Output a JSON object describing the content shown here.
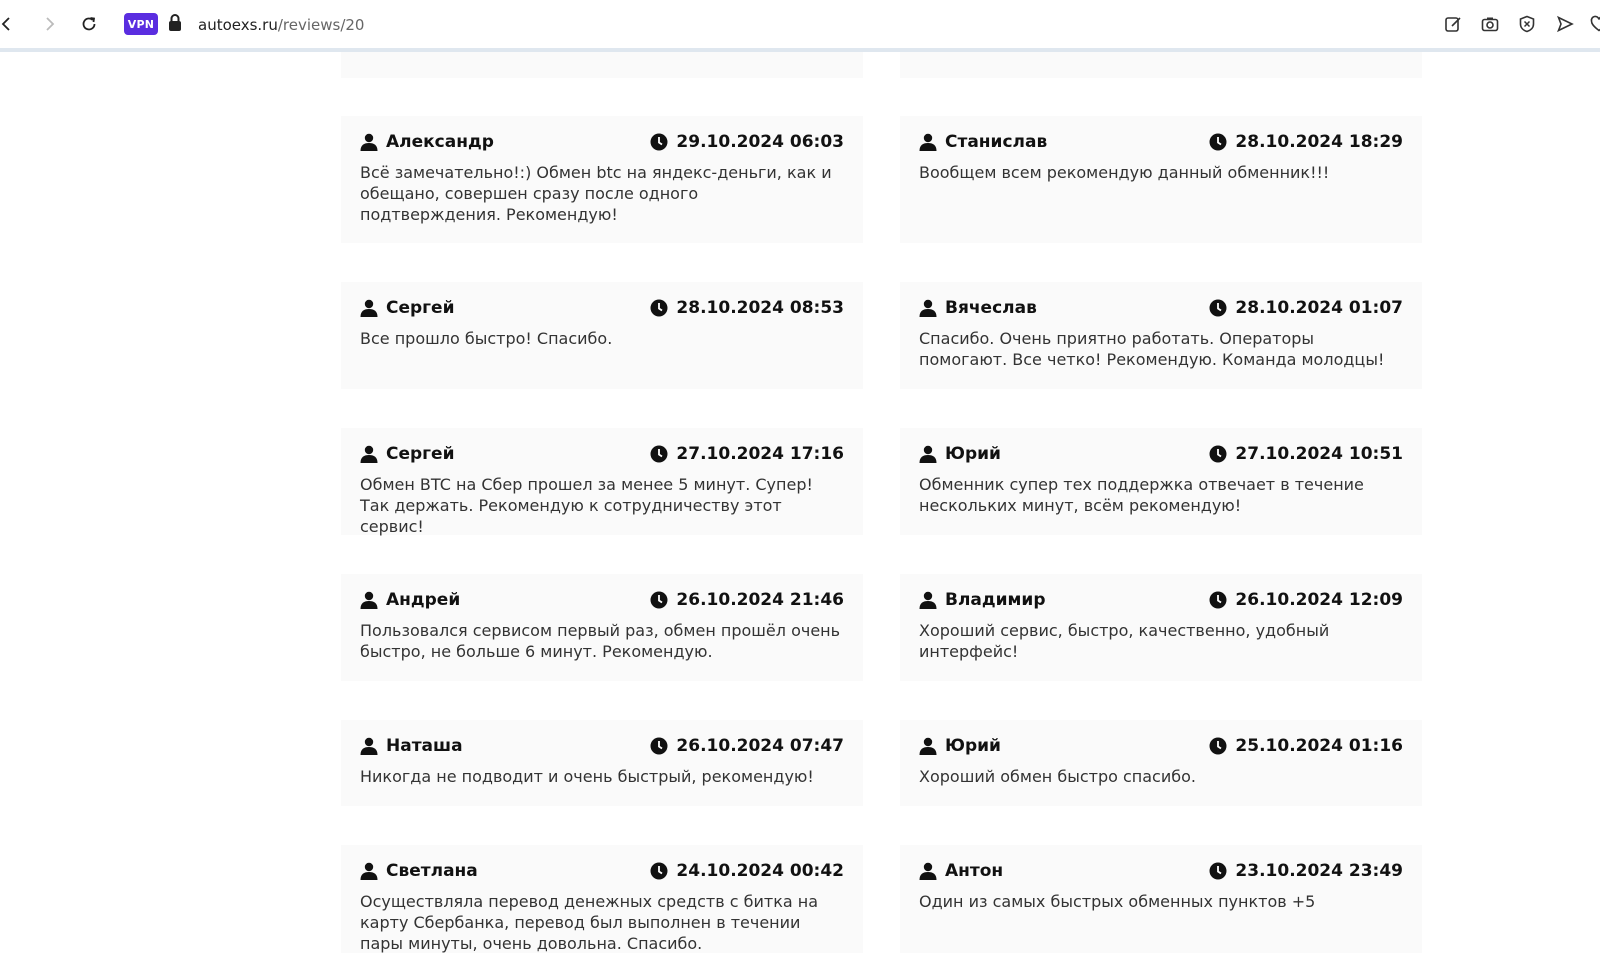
{
  "browser": {
    "vpn_label": "VPN",
    "url_domain": "autoexs.ru",
    "url_path": "/reviews/20"
  },
  "reviews": [
    {
      "author": "Александр",
      "date": "29.10.2024 06:03",
      "text": "Всё замечательно!:) Обмен btc на яндекс-деньги, как и обещано, совершен сразу после одного подтверждения. Рекомендую!"
    },
    {
      "author": "Станислав",
      "date": "28.10.2024 18:29",
      "text": "Вообщем всем рекомендую данный обменник!!!"
    },
    {
      "author": "Сергей",
      "date": "28.10.2024 08:53",
      "text": "Все прошло быстро! Спасибо."
    },
    {
      "author": "Вячеслав",
      "date": "28.10.2024 01:07",
      "text": "Спасибо. Очень приятно работать. Операторы помогают. Все четко! Рекомендую. Команда молодцы!"
    },
    {
      "author": "Сергей",
      "date": "27.10.2024 17:16",
      "text": "Обмен BTC на Сбер прошел за менее 5 минут. Супер! Так держать. Рекомендую к сотрудничеству этот сервис!"
    },
    {
      "author": "Юрий",
      "date": "27.10.2024 10:51",
      "text": "Обменник супер тех поддержка отвечает в течение нескольких минут, всём рекомендую!"
    },
    {
      "author": "Андрей",
      "date": "26.10.2024 21:46",
      "text": "Пользовался сервисом первый раз, обмен прошёл очень быстро, не больше 6 минут. Рекомендую."
    },
    {
      "author": "Владимир",
      "date": "26.10.2024 12:09",
      "text": "Хороший сервис, быстро, качественно, удобный интерфейс!"
    },
    {
      "author": "Наташа",
      "date": "26.10.2024 07:47",
      "text": "Никогда не подводит и очень быстрый, рекомендую!"
    },
    {
      "author": "Юрий",
      "date": "25.10.2024 01:16",
      "text": "Хороший обмен быстро спасибо."
    },
    {
      "author": "Светлана",
      "date": "24.10.2024 00:42",
      "text": "Осуществляла перевод денежных средств с битка на карту Сбербанка, перевод был выполнен в течении пары минуты, очень довольна. Спасибо."
    },
    {
      "author": "Антон",
      "date": "23.10.2024 23:49",
      "text": "Один из самых быстрых обменных пунктов +5"
    }
  ]
}
